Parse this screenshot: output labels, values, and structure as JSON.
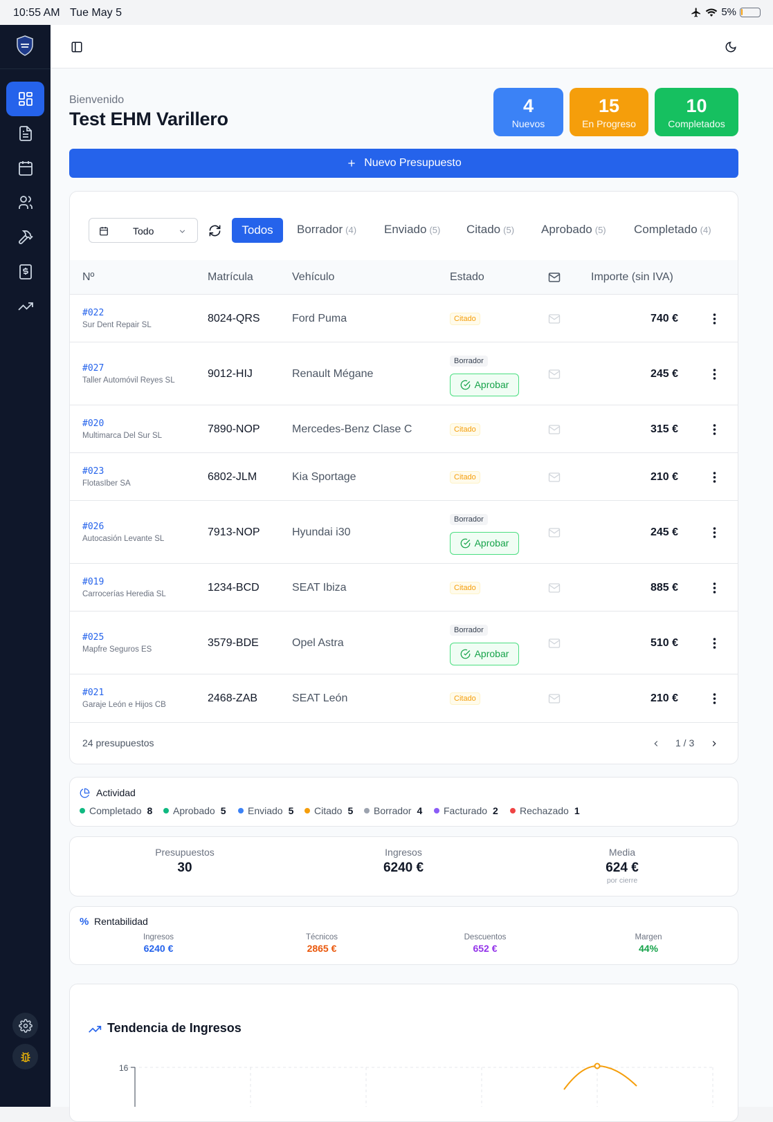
{
  "status_bar": {
    "time": "10:55 AM",
    "date": "Tue May 5",
    "battery": "5%"
  },
  "header": {
    "welcome_label": "Bienvenido",
    "user_name": "Test EHM Varillero"
  },
  "stats": [
    {
      "value": "4",
      "label": "Nuevos",
      "color": "#3b82f6"
    },
    {
      "value": "15",
      "label": "En Progreso",
      "color": "#f59e0b"
    },
    {
      "value": "10",
      "label": "Completados",
      "color": "#16c060"
    }
  ],
  "new_button_label": "Nuevo Presupuesto",
  "filter": {
    "period": "Todo"
  },
  "tabs": [
    {
      "label": "Todos",
      "count": ""
    },
    {
      "label": "Borrador",
      "count": "(4)"
    },
    {
      "label": "Enviado",
      "count": "(5)"
    },
    {
      "label": "Citado",
      "count": "(5)"
    },
    {
      "label": "Aprobado",
      "count": "(5)"
    },
    {
      "label": "Completado",
      "count": "(4)"
    }
  ],
  "table": {
    "headers": {
      "num": "Nº",
      "plate": "Matrícula",
      "vehicle": "Vehículo",
      "status": "Estado",
      "amount": "Importe (sin IVA)"
    },
    "rows": [
      {
        "id": "#022",
        "client": "Sur Dent Repair SL",
        "plate": "8024-QRS",
        "vehicle": "Ford Puma",
        "status": "Citado",
        "action": "",
        "amount": "740 €"
      },
      {
        "id": "#027",
        "client": "Taller Automóvil Reyes SL",
        "plate": "9012-HIJ",
        "vehicle": "Renault Mégane",
        "status": "Borrador",
        "action": "Aprobar",
        "amount": "245 €"
      },
      {
        "id": "#020",
        "client": "Multimarca Del Sur SL",
        "plate": "7890-NOP",
        "vehicle": "Mercedes-Benz Clase C",
        "status": "Citado",
        "action": "",
        "amount": "315 €"
      },
      {
        "id": "#023",
        "client": "FlotasIber SA",
        "plate": "6802-JLM",
        "vehicle": "Kia Sportage",
        "status": "Citado",
        "action": "",
        "amount": "210 €"
      },
      {
        "id": "#026",
        "client": "Autocasión Levante SL",
        "plate": "7913-NOP",
        "vehicle": "Hyundai i30",
        "status": "Borrador",
        "action": "Aprobar",
        "amount": "245 €"
      },
      {
        "id": "#019",
        "client": "Carrocerías Heredia SL",
        "plate": "1234-BCD",
        "vehicle": "SEAT Ibiza",
        "status": "Citado",
        "action": "",
        "amount": "885 €"
      },
      {
        "id": "#025",
        "client": "Mapfre Seguros ES",
        "plate": "3579-BDE",
        "vehicle": "Opel Astra",
        "status": "Borrador",
        "action": "Aprobar",
        "amount": "510 €"
      },
      {
        "id": "#021",
        "client": "Garaje León e Hijos CB",
        "plate": "2468-ZAB",
        "vehicle": "SEAT León",
        "status": "Citado",
        "action": "",
        "amount": "210 €"
      }
    ],
    "total_label": "24 presupuestos",
    "page": "1 / 3"
  },
  "activity": {
    "title": "Actividad",
    "items": [
      {
        "label": "Completado",
        "count": "8",
        "color": "#10b981"
      },
      {
        "label": "Aprobado",
        "count": "5",
        "color": "#10b981"
      },
      {
        "label": "Enviado",
        "count": "5",
        "color": "#3b82f6"
      },
      {
        "label": "Citado",
        "count": "5",
        "color": "#f59e0b"
      },
      {
        "label": "Borrador",
        "count": "4",
        "color": "#9ca3af"
      },
      {
        "label": "Facturado",
        "count": "2",
        "color": "#8b5cf6"
      },
      {
        "label": "Rechazado",
        "count": "1",
        "color": "#ef4444"
      }
    ]
  },
  "kpis": {
    "presupuestos": {
      "label": "Presupuestos",
      "value": "30"
    },
    "ingresos": {
      "label": "Ingresos",
      "value": "6240 €"
    },
    "media": {
      "label": "Media",
      "value": "624 €",
      "sub": "por cierre"
    }
  },
  "rentabilidad": {
    "title": "Rentabilidad",
    "items": [
      {
        "label": "Ingresos",
        "value": "6240 €",
        "color": "#2563eb"
      },
      {
        "label": "Técnicos",
        "value": "2865 €",
        "color": "#ea580c"
      },
      {
        "label": "Descuentos",
        "value": "652 €",
        "color": "#9333ea"
      },
      {
        "label": "Margen",
        "value": "44%",
        "color": "#16a34a"
      }
    ]
  },
  "trend": {
    "title": "Tendencia de Ingresos",
    "y_tick_top": "16"
  }
}
